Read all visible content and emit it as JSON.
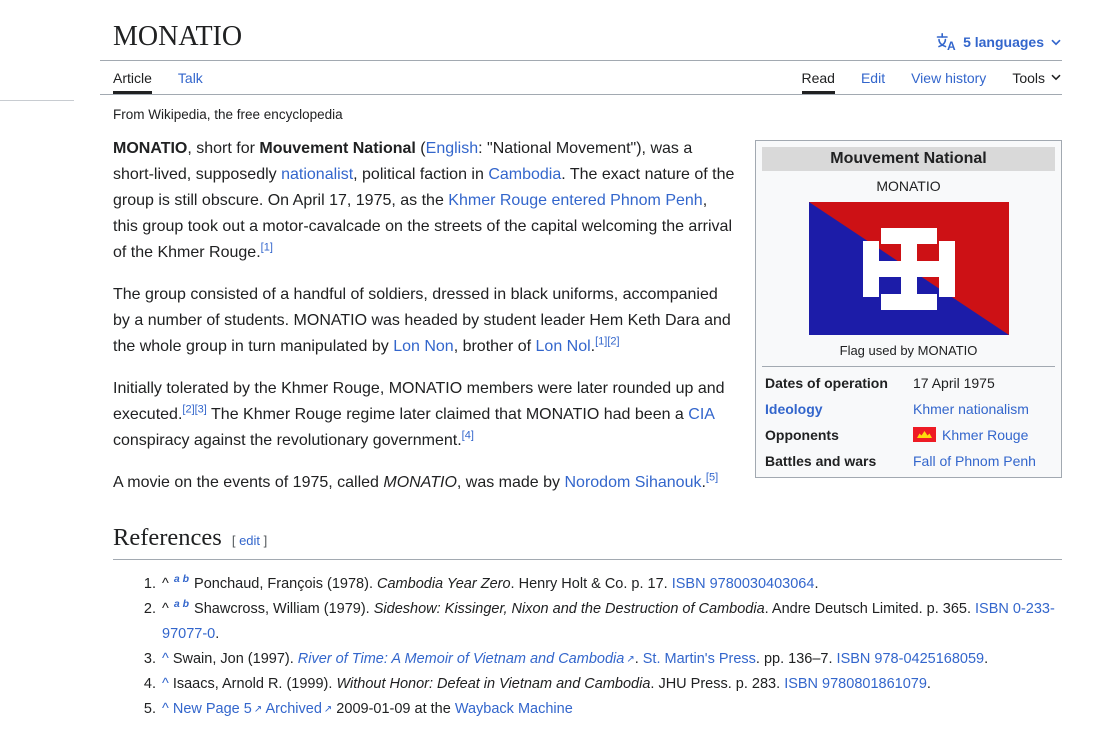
{
  "header": {
    "title": "MONATIO",
    "languages_label": "5 languages",
    "tabs_left": [
      {
        "label": "Article",
        "active": true
      },
      {
        "label": "Talk",
        "active": false
      }
    ],
    "tabs_right": [
      {
        "label": "Read",
        "active": true
      },
      {
        "label": "Edit",
        "active": false
      },
      {
        "label": "View history",
        "active": false
      },
      {
        "label": "Tools",
        "active": false
      }
    ],
    "tagline": "From Wikipedia, the free encyclopedia"
  },
  "article": {
    "paragraphs": [
      [
        {
          "s": "MONATIO",
          "type": "bold"
        },
        {
          "s": ", short for "
        },
        {
          "s": "Mouvement National",
          "type": "bold"
        },
        {
          "s": " ("
        },
        {
          "s": "English",
          "type": "link"
        },
        {
          "s": ": \"National Movement\"), was a short-lived, supposedly "
        },
        {
          "s": "nationalist",
          "type": "link"
        },
        {
          "s": ", political faction in "
        },
        {
          "s": "Cambodia",
          "type": "link"
        },
        {
          "s": ". The exact nature of the group is still obscure. On April 17, 1975, as the "
        },
        {
          "s": "Khmer Rouge entered Phnom Penh",
          "type": "link"
        },
        {
          "s": ", this group took out a motor-cavalcade on the streets of the capital welcoming the arrival of the Khmer Rouge."
        },
        {
          "s": "[1]",
          "type": "ref"
        }
      ],
      [
        {
          "s": "The group consisted of a handful of soldiers, dressed in black uniforms, accompanied by a number of students. MONATIO was headed by student leader Hem Keth Dara and the whole group in turn manipulated by "
        },
        {
          "s": "Lon Non",
          "type": "link"
        },
        {
          "s": ", brother of "
        },
        {
          "s": "Lon Nol",
          "type": "link"
        },
        {
          "s": "."
        },
        {
          "s": "[1]",
          "type": "ref"
        },
        {
          "s": "[2]",
          "type": "ref"
        }
      ],
      [
        {
          "s": "Initially tolerated by the Khmer Rouge, MONATIO members were later rounded up and executed."
        },
        {
          "s": "[2]",
          "type": "ref"
        },
        {
          "s": "[3]",
          "type": "ref"
        },
        {
          "s": " The Khmer Rouge regime later claimed that MONATIO had been a "
        },
        {
          "s": "CIA",
          "type": "link"
        },
        {
          "s": " conspiracy against the revolutionary government."
        },
        {
          "s": "[4]",
          "type": "ref"
        }
      ],
      [
        {
          "s": "A movie on the events of 1975, called "
        },
        {
          "s": "MONATIO",
          "type": "italic"
        },
        {
          "s": ", was made by "
        },
        {
          "s": "Norodom Sihanouk",
          "type": "link"
        },
        {
          "s": "."
        },
        {
          "s": "[5]",
          "type": "ref"
        }
      ]
    ]
  },
  "infobox": {
    "title": "Mouvement National",
    "subtitle": "MONATIO",
    "caption": "Flag used by MONATIO",
    "flag_colors": {
      "red": "#cd1115",
      "blue": "#1c1ca8",
      "cross": "#ffffff"
    },
    "kr_flag_colors": {
      "red": "#ee1b24",
      "yellow": "#ffd90c"
    },
    "rows": [
      {
        "label": "Dates of operation",
        "value": "17 April 1975"
      },
      {
        "label": "Ideology",
        "value": "Khmer nationalism"
      },
      {
        "label": "Opponents",
        "value": "Khmer Rouge"
      },
      {
        "label": "Battles and wars",
        "value": "Fall of Phnom Penh"
      }
    ]
  },
  "references": {
    "heading": "References",
    "edit_open": "[ ",
    "edit_label": "edit",
    "edit_close": " ]",
    "items": [
      [
        {
          "s": "^ "
        },
        {
          "s": "a b",
          "type": "letters"
        },
        {
          "s": " Ponchaud, François (1978). "
        },
        {
          "s": "Cambodia Year Zero",
          "type": "italic"
        },
        {
          "s": ". Henry Holt & Co. p. 17. "
        },
        {
          "s": "ISBN 9780030403064",
          "type": "link"
        },
        {
          "s": "."
        }
      ],
      [
        {
          "s": "^ "
        },
        {
          "s": "a b",
          "type": "letters"
        },
        {
          "s": " Shawcross, William (1979). "
        },
        {
          "s": "Sideshow: Kissinger, Nixon and the Destruction of Cambodia",
          "type": "italic"
        },
        {
          "s": ". Andre Deutsch Limited. p. 365. "
        },
        {
          "s": "ISBN 0-233-97077-0",
          "type": "link"
        },
        {
          "s": "."
        }
      ],
      [
        {
          "s": "^",
          "type": "link"
        },
        {
          "s": " Swain, Jon (1997). "
        },
        {
          "s": "River of Time: A Memoir of Vietnam and Cambodia",
          "type": "ext-italic"
        },
        {
          "s": ". "
        },
        {
          "s": "St. Martin's Press",
          "type": "link"
        },
        {
          "s": ". pp. 136–7. "
        },
        {
          "s": "ISBN 978-0425168059",
          "type": "link"
        },
        {
          "s": "."
        }
      ],
      [
        {
          "s": "^",
          "type": "link"
        },
        {
          "s": " Isaacs, Arnold R. (1999). "
        },
        {
          "s": "Without Honor: Defeat in Vietnam and Cambodia",
          "type": "italic"
        },
        {
          "s": ". JHU Press. p. 283. "
        },
        {
          "s": "ISBN 9780801861079",
          "type": "link"
        },
        {
          "s": "."
        }
      ],
      [
        {
          "s": "^",
          "type": "link"
        },
        {
          "s": " "
        },
        {
          "s": "New Page 5",
          "type": "ext"
        },
        {
          "s": " "
        },
        {
          "s": "Archived",
          "type": "ext"
        },
        {
          "s": " 2009-01-09 at the "
        },
        {
          "s": "Wayback Machine",
          "type": "link"
        }
      ]
    ]
  },
  "icons": {
    "external_link": "↗"
  }
}
